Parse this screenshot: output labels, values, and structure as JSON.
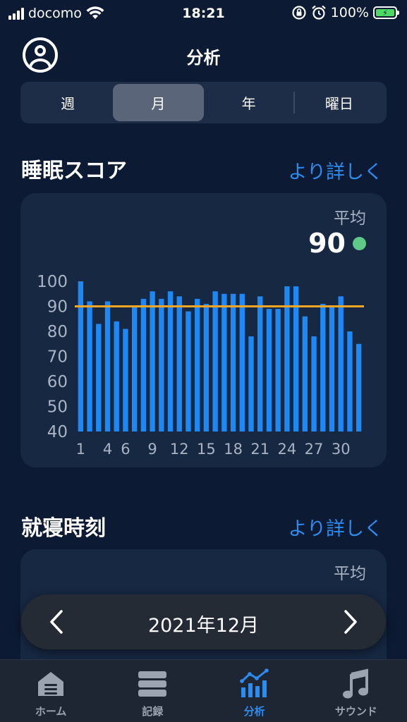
{
  "status_bar": {
    "carrier": "docomo",
    "time": "18:21",
    "battery": "100%"
  },
  "header": {
    "title": "分析"
  },
  "segments": [
    {
      "label": "週",
      "active": false
    },
    {
      "label": "月",
      "active": true
    },
    {
      "label": "年",
      "active": false
    },
    {
      "label": "曜日",
      "active": false
    }
  ],
  "sleep_score": {
    "title": "睡眠スコア",
    "link": "より詳しく",
    "avg_label": "平均",
    "avg_value": "90",
    "avg_dot_color": "#5ec988"
  },
  "bedtime": {
    "title": "就寝時刻",
    "link": "より詳しく",
    "avg_label": "平均"
  },
  "chart_data": {
    "type": "bar",
    "x": [
      1,
      2,
      3,
      4,
      5,
      6,
      7,
      8,
      9,
      10,
      11,
      12,
      13,
      14,
      15,
      16,
      17,
      18,
      19,
      20,
      21,
      22,
      23,
      24,
      25,
      26,
      27,
      28,
      29,
      30,
      31
    ],
    "values": [
      100,
      92,
      83,
      92,
      84,
      81,
      90,
      93,
      96,
      93,
      96,
      94,
      88,
      93,
      91,
      96,
      95,
      95,
      95,
      78,
      94,
      89,
      89,
      98,
      98,
      86,
      78,
      91,
      90,
      94,
      80,
      75
    ],
    "x_tick_labels": [
      "1",
      "4",
      "6",
      "9",
      "12",
      "15",
      "18",
      "21",
      "24",
      "27",
      "30"
    ],
    "y_tick_labels": [
      "100",
      "90",
      "80",
      "70",
      "60",
      "50",
      "40"
    ],
    "ylim": [
      40,
      100
    ],
    "average_line": 90,
    "bar_color": "#1e88f5",
    "average_line_color": "#f5a623",
    "grid": false
  },
  "month_nav": {
    "label": "2021年12月"
  },
  "tab_bar": [
    {
      "label": "ホーム",
      "icon": "home-icon",
      "active": false
    },
    {
      "label": "記録",
      "icon": "records-icon",
      "active": false
    },
    {
      "label": "分析",
      "icon": "analysis-icon",
      "active": true
    },
    {
      "label": "サウンド",
      "icon": "music-note-icon",
      "active": false
    }
  ]
}
